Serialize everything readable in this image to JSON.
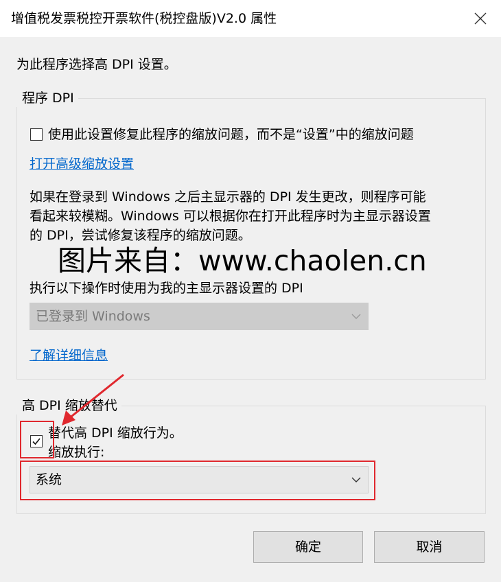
{
  "window": {
    "title": "增值税发票税控开票软件(税控盘版)V2.0 属性",
    "close_icon": "close-icon"
  },
  "intro": "为此程序选择高 DPI 设置。",
  "program_dpi": {
    "legend": "程序 DPI",
    "checkbox_label": "使用此设置修复此程序的缩放问题，而不是“设置”中的缩放问题",
    "checkbox_checked": false,
    "advanced_link": "打开高级缩放设置",
    "description_lines": [
      "如果在登录到 Windows 之后主显示器的 DPI 发生更改，则程序可能",
      "看起来较模糊。Windows 可以根据你在打开此程序时为主显示器设置",
      "的 DPI，尝试修复该程序的缩放问题。"
    ],
    "dpi_when_label": "执行以下操作时使用为我的主显示器设置的 DPI",
    "dpi_when_value": "已登录到 Windows",
    "learn_more_link": "了解详细信息"
  },
  "watermark": "图片来自：www.chaolen.cn",
  "override": {
    "legend": "高 DPI 缩放替代",
    "checkbox_label": "替代高 DPI 缩放行为。",
    "checkbox_checked": true,
    "performed_by_label": "缩放执行:",
    "performed_by_value": "系统"
  },
  "buttons": {
    "ok": "确定",
    "cancel": "取消"
  },
  "colors": {
    "highlight": "#e0282e",
    "link": "#0066cc"
  }
}
